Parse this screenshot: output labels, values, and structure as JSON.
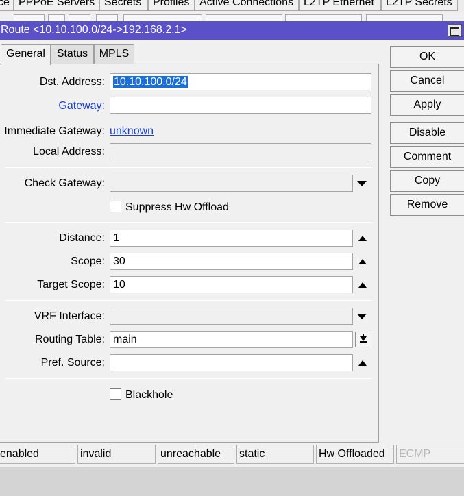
{
  "background_tabs": [
    "ce",
    "PPPoE Servers",
    "Secrets",
    "Profiles",
    "Active Connections",
    "L2TP Ethernet",
    "L2TP Secrets"
  ],
  "window": {
    "title": "Route <10.10.100.0/24->192.168.2.1>",
    "maximize_icon": "maximize-icon"
  },
  "tabs": [
    "General",
    "Status",
    "MPLS"
  ],
  "active_tab": "General",
  "form": {
    "dst_address": {
      "label": "Dst. Address:",
      "value": "10.10.100.0/24"
    },
    "gateway": {
      "label": "Gateway:",
      "value": ""
    },
    "immediate_gateway": {
      "label": "Immediate Gateway:",
      "value": "unknown"
    },
    "local_address": {
      "label": "Local Address:",
      "value": ""
    },
    "check_gateway": {
      "label": "Check Gateway:",
      "value": ""
    },
    "suppress_hw_offload": {
      "label": "Suppress Hw Offload",
      "checked": false
    },
    "distance": {
      "label": "Distance:",
      "value": "1"
    },
    "scope": {
      "label": "Scope:",
      "value": "30"
    },
    "target_scope": {
      "label": "Target Scope:",
      "value": "10"
    },
    "vrf_interface": {
      "label": "VRF Interface:",
      "value": ""
    },
    "routing_table": {
      "label": "Routing Table:",
      "value": "main"
    },
    "pref_source": {
      "label": "Pref. Source:",
      "value": ""
    },
    "blackhole": {
      "label": "Blackhole",
      "checked": false
    }
  },
  "buttons": [
    "OK",
    "Cancel",
    "Apply",
    "Disable",
    "Comment",
    "Copy",
    "Remove"
  ],
  "status_bar": [
    "enabled",
    "invalid",
    "unreachable",
    "static",
    "Hw Offloaded",
    "ECMP"
  ],
  "colors": {
    "titlebar": "#5a50c8",
    "link": "#1a3fd0",
    "selection": "#1b6fd6",
    "disabled_text": "#b8b8b8"
  }
}
